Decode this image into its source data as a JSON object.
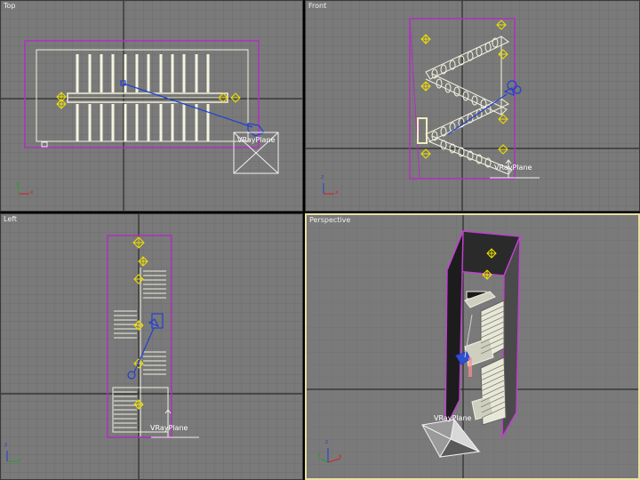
{
  "viewports": {
    "top": {
      "label": "Top",
      "object_label": "VRayPlane"
    },
    "front": {
      "label": "Front",
      "object_label": "VRayPlane"
    },
    "left": {
      "label": "Left",
      "object_label": "VRayPlane"
    },
    "perspective": {
      "label": "Perspective",
      "object_label": "VRayPlane"
    }
  },
  "axis_labels": {
    "x": "x",
    "y": "y",
    "z": "z"
  },
  "colors": {
    "viewport_bg": "#7a7a7a",
    "grid_minor": "#6e6e6e",
    "grid_major": "#2a2a2a",
    "wall_outline": "#a020c0",
    "stair_white": "#f0f0d8",
    "light_gizmo": "#f0e000",
    "camera_blue": "#2040d0",
    "active_border": "#e8e0a0"
  }
}
